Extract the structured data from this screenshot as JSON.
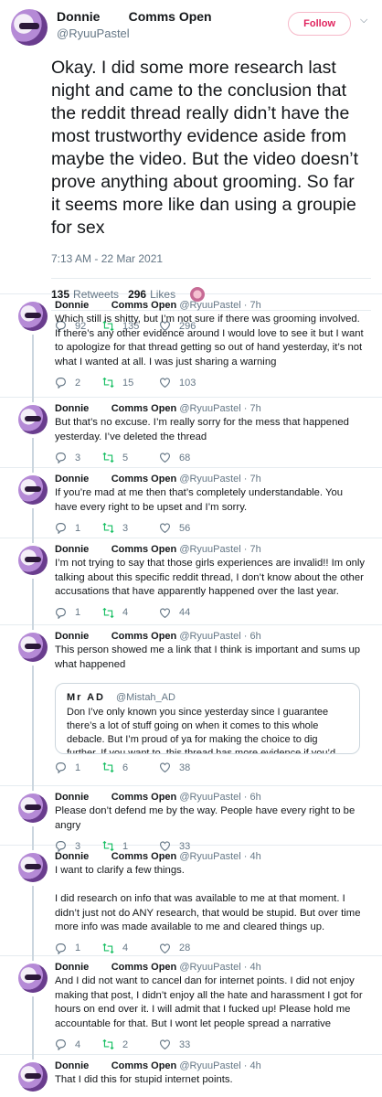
{
  "main": {
    "name": "Donnie",
    "status": "Comms Open",
    "handle": "@RyuuPastel",
    "follow_label": "Follow",
    "text": "Okay. I did some more research last night and came to the conclusion that the reddit thread really didn’t have the most trustworthy evidence aside from maybe the video. But the video doesn’t prove anything about grooming. So far it seems more like dan using a groupie for sex",
    "timestamp": "7:13 AM - 22 Mar 2021",
    "retweets_count": "135",
    "retweets_label": "Retweets",
    "likes_count": "296",
    "likes_label": "Likes",
    "replies": "92",
    "retweets": "135",
    "likes": "296"
  },
  "replies": [
    {
      "name": "Donnie",
      "status": "Comms Open",
      "handle": "@RyuuPastel",
      "time": "7h",
      "text": "Which still is shitty, but I’m not sure if there was grooming involved. If there’s any other evidence around I would love to see it but I want to apologize for that thread getting so out of hand yesterday, it’s not what I wanted at all. I was just sharing a warning",
      "replies": "2",
      "retweets": "15",
      "likes": "103"
    },
    {
      "name": "Donnie",
      "status": "Comms Open",
      "handle": "@RyuuPastel",
      "time": "7h",
      "text": "But that’s no excuse. I’m really sorry for the mess that happened yesterday. I’ve deleted the thread",
      "replies": "3",
      "retweets": "5",
      "likes": "68"
    },
    {
      "name": "Donnie",
      "status": "Comms Open",
      "handle": "@RyuuPastel",
      "time": "7h",
      "text": "If you’re mad at me then that’s completely understandable. You have every right to be upset and I’m sorry.",
      "replies": "1",
      "retweets": "3",
      "likes": "56"
    },
    {
      "name": "Donnie",
      "status": "Comms Open",
      "handle": "@RyuuPastel",
      "time": "7h",
      "text": "I’m not trying to say that those girls experiences are invalid!! Im only talking about this specific reddit thread, I don’t know about the other accusations that have apparently happened over the last year.",
      "replies": "1",
      "retweets": "4",
      "likes": "44"
    },
    {
      "name": "Donnie",
      "status": "Comms Open",
      "handle": "@RyuuPastel",
      "time": "6h",
      "text": "This person showed me a link that I think is important and sums up what happened",
      "quote": {
        "name": "Mr AD",
        "handle": "@Mistah_AD",
        "text": "Don I’ve only known you since yesterday since I guarantee there’s a lot of stuff going on when it comes to this whole debacle. But I’m proud of ya for making the choice to dig further. If you want to, this thread has more evidence if you’d like to look"
      },
      "replies": "1",
      "retweets": "6",
      "likes": "38"
    },
    {
      "name": "Donnie",
      "status": "Comms Open",
      "handle": "@RyuuPastel",
      "time": "6h",
      "text": "Please don’t defend me by the way. People have every right to be angry",
      "replies": "3",
      "retweets": "1",
      "likes": "33"
    },
    {
      "name": "Donnie",
      "status": "Comms Open",
      "handle": "@RyuuPastel",
      "time": "4h",
      "text": "I want to clarify a few things.\n\nI did research on info that was available to me at that moment. I didn’t just not do ANY research, that would be stupid. But over time more info was made available to me and cleared things up.",
      "replies": "1",
      "retweets": "4",
      "likes": "28"
    },
    {
      "name": "Donnie",
      "status": "Comms Open",
      "handle": "@RyuuPastel",
      "time": "4h",
      "text": "And I did not want to cancel dan for internet points. I did not enjoy making that post, I didn’t enjoy all the hate and harassment I got for hours on end over it. I will admit that I fucked up! Please hold me accountable for that. But I wont let people spread a narrative",
      "replies": "4",
      "retweets": "2",
      "likes": "33"
    },
    {
      "name": "Donnie",
      "status": "Comms Open",
      "handle": "@RyuuPastel",
      "time": "4h",
      "text": "That I did this for stupid internet points.",
      "replies": "",
      "retweets": "",
      "likes": ""
    }
  ]
}
